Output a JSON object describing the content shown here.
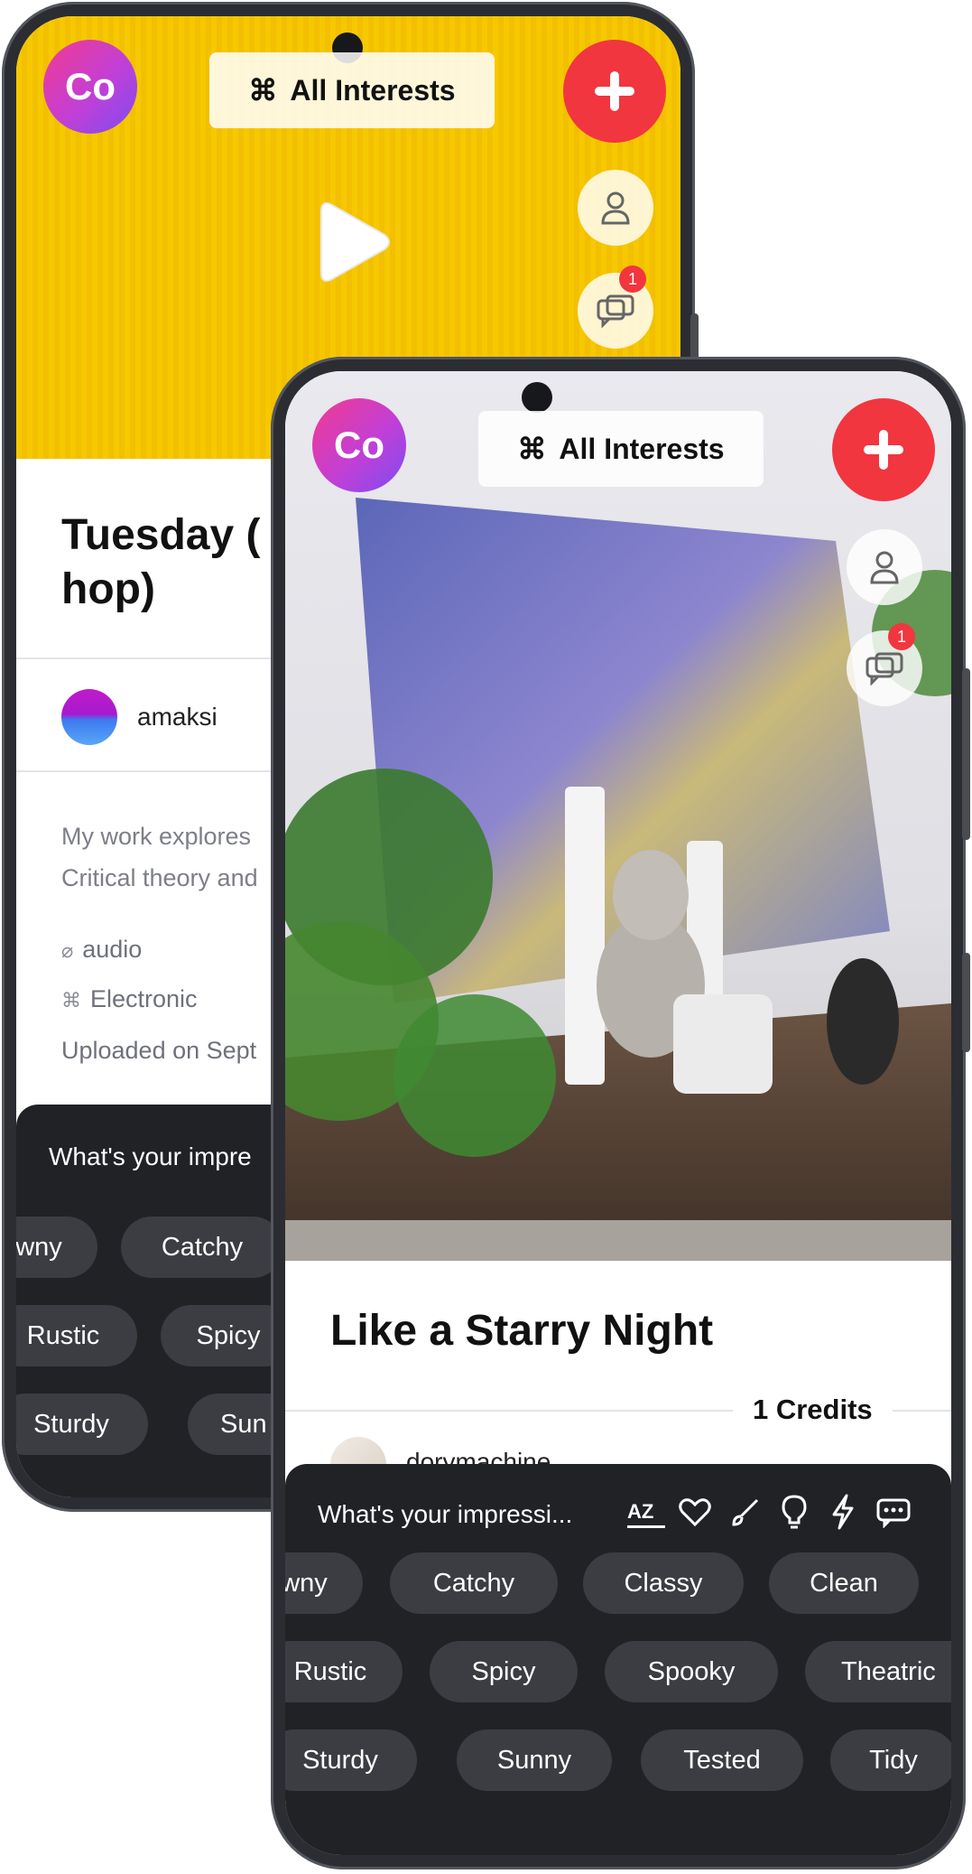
{
  "back_screen": {
    "avatar_label": "Co",
    "interests_icon": "⌘",
    "interests_label": "All Interests",
    "messages_badge": "1",
    "title": "Tuesday (",
    "title_line2": "hop)",
    "username": "amaksi",
    "description_line1": "My work explores",
    "description_line2": "Critical theory and",
    "media_type": "audio",
    "genre": "Electronic",
    "uploaded": "Uploaded on Sept",
    "prompt": "What's your impre",
    "chips_row1": [
      "wny",
      "Catchy"
    ],
    "chips_row2": [
      "Rustic",
      "Spicy"
    ],
    "chips_row3": [
      "Sturdy",
      "Sun"
    ]
  },
  "front_screen": {
    "avatar_label": "Co",
    "interests_icon": "⌘",
    "interests_label": "All Interests",
    "messages_badge": "1",
    "title": "Like a Starry Night",
    "credits": "1 Credits",
    "username": "dorymachine",
    "prompt": "What's your impressi...",
    "toolbar_icons": [
      "az-sort-icon",
      "heart-icon",
      "brush-icon",
      "lightbulb-icon",
      "lightning-icon",
      "chat-dots-icon"
    ],
    "chips_row1": [
      "wny",
      "Catchy",
      "Classy",
      "Clean"
    ],
    "chips_row2": [
      "Rustic",
      "Spicy",
      "Spooky",
      "Theatric"
    ],
    "chips_row3": [
      "Sturdy",
      "Sunny",
      "Tested",
      "Tidy"
    ]
  },
  "colors": {
    "accent_red": "#f1363f",
    "yellow_bg": "#f6c800",
    "dark_panel": "#202226",
    "chip_bg": "#3b3d43"
  }
}
